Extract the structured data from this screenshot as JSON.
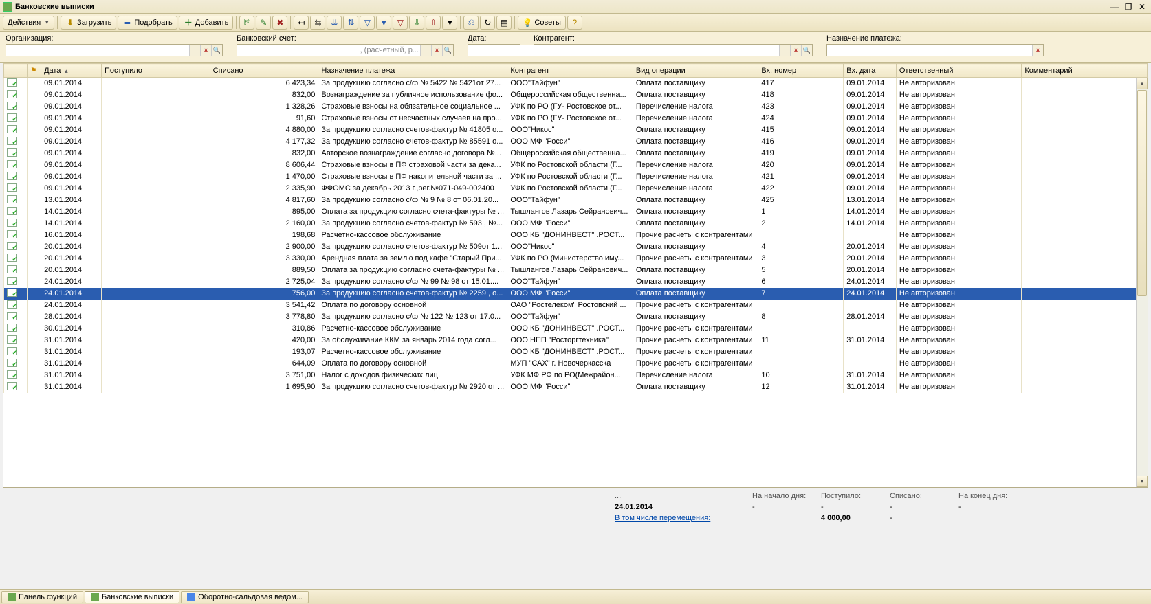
{
  "title": "Банковские выписки",
  "toolbar": {
    "actions": "Действия",
    "load": "Загрузить",
    "pick": "Подобрать",
    "add": "Добавить",
    "tips": "Советы"
  },
  "filters": {
    "org_lbl": "Организация:",
    "org_val": "",
    "bank_lbl": "Банковский счет:",
    "bank_val": "",
    "bank_hint": ", (расчетный, р...",
    "date_lbl": "Дата:",
    "contr_lbl": "Контрагент:",
    "purpose_lbl": "Назначение платежа:"
  },
  "columns": [
    "",
    "",
    "Дата",
    "Поступило",
    "Списано",
    "Назначение платежа",
    "Контрагент",
    "Вид операции",
    "Вх. номер",
    "Вх. дата",
    "Ответственный",
    "Комментарий"
  ],
  "rows": [
    {
      "d": "09.01.2014",
      "in": "",
      "out": "6 423,34",
      "p": "За продукцию согласно с/ф № 5422  № 5421от 27...",
      "c": "ООО\"Тайфун\"",
      "op": "Оплата поставщику",
      "inum": "417",
      "idate": "09.01.2014",
      "resp": "Не авторизован",
      "k": ""
    },
    {
      "d": "09.01.2014",
      "in": "",
      "out": "832,00",
      "p": "Вознаграждение за публичное использование фо...",
      "c": "Общероссийская общественна...",
      "op": "Оплата поставщику",
      "inum": "418",
      "idate": "09.01.2014",
      "resp": "Не авторизован",
      "k": ""
    },
    {
      "d": "09.01.2014",
      "in": "",
      "out": "1 328,26",
      "p": "Страховые взносы  на обязательное социальное ...",
      "c": "УФК по РО (ГУ- Ростовское от...",
      "op": "Перечисление налога",
      "inum": "423",
      "idate": "09.01.2014",
      "resp": "Не авторизован",
      "k": ""
    },
    {
      "d": "09.01.2014",
      "in": "",
      "out": "91,60",
      "p": "Страховые взносы от несчастных случаев на про...",
      "c": "УФК по РО (ГУ- Ростовское от...",
      "op": "Перечисление налога",
      "inum": "424",
      "idate": "09.01.2014",
      "resp": "Не авторизован",
      "k": ""
    },
    {
      "d": "09.01.2014",
      "in": "",
      "out": "4 880,00",
      "p": "За продукцию согласно счетов-фактур  № 41805 о...",
      "c": "ООО\"Никос\"",
      "op": "Оплата поставщику",
      "inum": "415",
      "idate": "09.01.2014",
      "resp": "Не авторизован",
      "k": ""
    },
    {
      "d": "09.01.2014",
      "in": "",
      "out": "4 177,32",
      "p": "За продукцию согласно счетов-фактур № 85591 о...",
      "c": "ООО МФ \"Росси\"",
      "op": "Оплата поставщику",
      "inum": "416",
      "idate": "09.01.2014",
      "resp": "Не авторизован",
      "k": ""
    },
    {
      "d": "09.01.2014",
      "in": "",
      "out": "832,00",
      "p": "Авторское вознаграждение согласно договора №...",
      "c": "Общероссийская общественна...",
      "op": "Оплата поставщику",
      "inum": "419",
      "idate": "09.01.2014",
      "resp": "Не авторизован",
      "k": ""
    },
    {
      "d": "09.01.2014",
      "in": "",
      "out": "8 606,44",
      "p": "Страховые взносы в ПФ страховой части за дека...",
      "c": "УФК по Ростовской области (Г...",
      "op": "Перечисление налога",
      "inum": "420",
      "idate": "09.01.2014",
      "resp": "Не авторизован",
      "k": ""
    },
    {
      "d": "09.01.2014",
      "in": "",
      "out": "1 470,00",
      "p": "Страховые взносы в ПФ накопительной части за ...",
      "c": "УФК по Ростовской области (Г...",
      "op": "Перечисление налога",
      "inum": "421",
      "idate": "09.01.2014",
      "resp": "Не авторизован",
      "k": ""
    },
    {
      "d": "09.01.2014",
      "in": "",
      "out": "2 335,90",
      "p": "ФФОМС  за  декабрь 2013 г.,рег.№071-049-002400",
      "c": "УФК по Ростовской области (Г...",
      "op": "Перечисление налога",
      "inum": "422",
      "idate": "09.01.2014",
      "resp": "Не авторизован",
      "k": ""
    },
    {
      "d": "13.01.2014",
      "in": "",
      "out": "4 817,60",
      "p": "За продукцию согласно с/ф № 9  № 8 от 06.01.20...",
      "c": "ООО\"Тайфун\"",
      "op": "Оплата поставщику",
      "inum": "425",
      "idate": "13.01.2014",
      "resp": "Не авторизован",
      "k": ""
    },
    {
      "d": "14.01.2014",
      "in": "",
      "out": "895,00",
      "p": "Оплата за продукцию согласно счета-фактуры № ...",
      "c": "Тышлангов Лазарь Сейранович...",
      "op": "Оплата поставщику",
      "inum": "1",
      "idate": "14.01.2014",
      "resp": "Не авторизован",
      "k": ""
    },
    {
      "d": "14.01.2014",
      "in": "",
      "out": "2 160,00",
      "p": "За продукцию согласно счетов-фактур № 593 , №...",
      "c": "ООО МФ \"Росси\"",
      "op": "Оплата поставщику",
      "inum": "2",
      "idate": "14.01.2014",
      "resp": "Не авторизован",
      "k": ""
    },
    {
      "d": "16.01.2014",
      "in": "",
      "out": "198,68",
      "p": "Расчетно-кассовое обслуживание",
      "c": "ООО КБ \"ДОНИНВЕСТ\" .РОСТ...",
      "op": "Прочие расчеты с контрагентами",
      "inum": "",
      "idate": "",
      "resp": "Не авторизован",
      "k": ""
    },
    {
      "d": "20.01.2014",
      "in": "",
      "out": "2 900,00",
      "p": "За продукцию согласно счетов-фактур  № 509от 1...",
      "c": "ООО\"Никос\"",
      "op": "Оплата поставщику",
      "inum": "4",
      "idate": "20.01.2014",
      "resp": "Не авторизован",
      "k": ""
    },
    {
      "d": "20.01.2014",
      "in": "",
      "out": "3 330,00",
      "p": "Арендная плата за землю под кафе \"Старый При...",
      "c": "УФК по РО (Министерство иму...",
      "op": "Прочие расчеты с контрагентами",
      "inum": "3",
      "idate": "20.01.2014",
      "resp": "Не авторизован",
      "k": ""
    },
    {
      "d": "20.01.2014",
      "in": "",
      "out": "889,50",
      "p": "Оплата за продукцию согласно счета-фактуры № ...",
      "c": "Тышлангов Лазарь Сейранович...",
      "op": "Оплата поставщику",
      "inum": "5",
      "idate": "20.01.2014",
      "resp": "Не авторизован",
      "k": ""
    },
    {
      "d": "24.01.2014",
      "in": "",
      "out": "2 725,04",
      "p": "За продукцию согласно с/ф № 99  № 98 от 15.01....",
      "c": "ООО\"Тайфун\"",
      "op": "Оплата поставщику",
      "inum": "6",
      "idate": "24.01.2014",
      "resp": "Не авторизован",
      "k": ""
    },
    {
      "d": "24.01.2014",
      "in": "",
      "out": "756,00",
      "p": "За продукцию согласно счетов-фактур № 2259 , о...",
      "c": "ООО МФ \"Росси\"",
      "op": "Оплата поставщику",
      "inum": "7",
      "idate": "24.01.2014",
      "resp": "Не авторизован",
      "k": "",
      "sel": true
    },
    {
      "d": "24.01.2014",
      "in": "",
      "out": "3 541,42",
      "p": "Оплата по договору основной",
      "c": "ОАО \"Ростелеком\" Ростовский ...",
      "op": "Прочие расчеты с контрагентами",
      "inum": "",
      "idate": "",
      "resp": "Не авторизован",
      "k": ""
    },
    {
      "d": "28.01.2014",
      "in": "",
      "out": "3 778,80",
      "p": "За продукцию согласно с/ф № 122  № 123 от 17.0...",
      "c": "ООО\"Тайфун\"",
      "op": "Оплата поставщику",
      "inum": "8",
      "idate": "28.01.2014",
      "resp": "Не авторизован",
      "k": ""
    },
    {
      "d": "30.01.2014",
      "in": "",
      "out": "310,86",
      "p": "Расчетно-кассовое обслуживание",
      "c": "ООО КБ \"ДОНИНВЕСТ\" .РОСТ...",
      "op": "Прочие расчеты с контрагентами",
      "inum": "",
      "idate": "",
      "resp": "Не авторизован",
      "k": ""
    },
    {
      "d": "31.01.2014",
      "in": "",
      "out": "420,00",
      "p": "За обслуживание ККМ за январь  2014 года согл...",
      "c": "ООО НПП \"Росторгтехника\"",
      "op": "Прочие расчеты с контрагентами",
      "inum": "11",
      "idate": "31.01.2014",
      "resp": "Не авторизован",
      "k": ""
    },
    {
      "d": "31.01.2014",
      "in": "",
      "out": "193,07",
      "p": "Расчетно-кассовое обслуживание",
      "c": "ООО КБ \"ДОНИНВЕСТ\" .РОСТ...",
      "op": "Прочие расчеты с контрагентами",
      "inum": "",
      "idate": "",
      "resp": "Не авторизован",
      "k": ""
    },
    {
      "d": "31.01.2014",
      "in": "",
      "out": "644,09",
      "p": "Оплата по договору основной",
      "c": "МУП \"САХ\" г. Новочеркасска",
      "op": "Прочие расчеты с контрагентами",
      "inum": "",
      "idate": "",
      "resp": "Не авторизован",
      "k": ""
    },
    {
      "d": "31.01.2014",
      "in": "",
      "out": "3 751,00",
      "p": "Налог с доходов физических лиц.",
      "c": "УФК МФ РФ по РО(Межрайон...",
      "op": "Перечисление налога",
      "inum": "10",
      "idate": "31.01.2014",
      "resp": "Не авторизован",
      "k": ""
    },
    {
      "d": "31.01.2014",
      "in": "",
      "out": "1 695,90",
      "p": "За продукцию согласно счетов-фактур № 2920 от ...",
      "c": "ООО МФ \"Росси\"",
      "op": "Оплата поставщику",
      "inum": "12",
      "idate": "31.01.2014",
      "resp": "Не авторизован",
      "k": ""
    }
  ],
  "summary": {
    "acct_ellip": "...",
    "date": "24.01.2014",
    "link": "В том числе перемещения:",
    "start_lbl": "На начало дня:",
    "start_val": "-",
    "in_lbl": "Поступило:",
    "in_val": "-",
    "in_val2": "4 000,00",
    "out_lbl": "Списано:",
    "out_val": "-",
    "out_val2": "-",
    "end_lbl": "На конец дня:",
    "end_val": "-"
  },
  "taskbar": {
    "t1": "Панель функций",
    "t2": "Банковские выписки",
    "t3": "Оборотно-сальдовая ведом..."
  }
}
